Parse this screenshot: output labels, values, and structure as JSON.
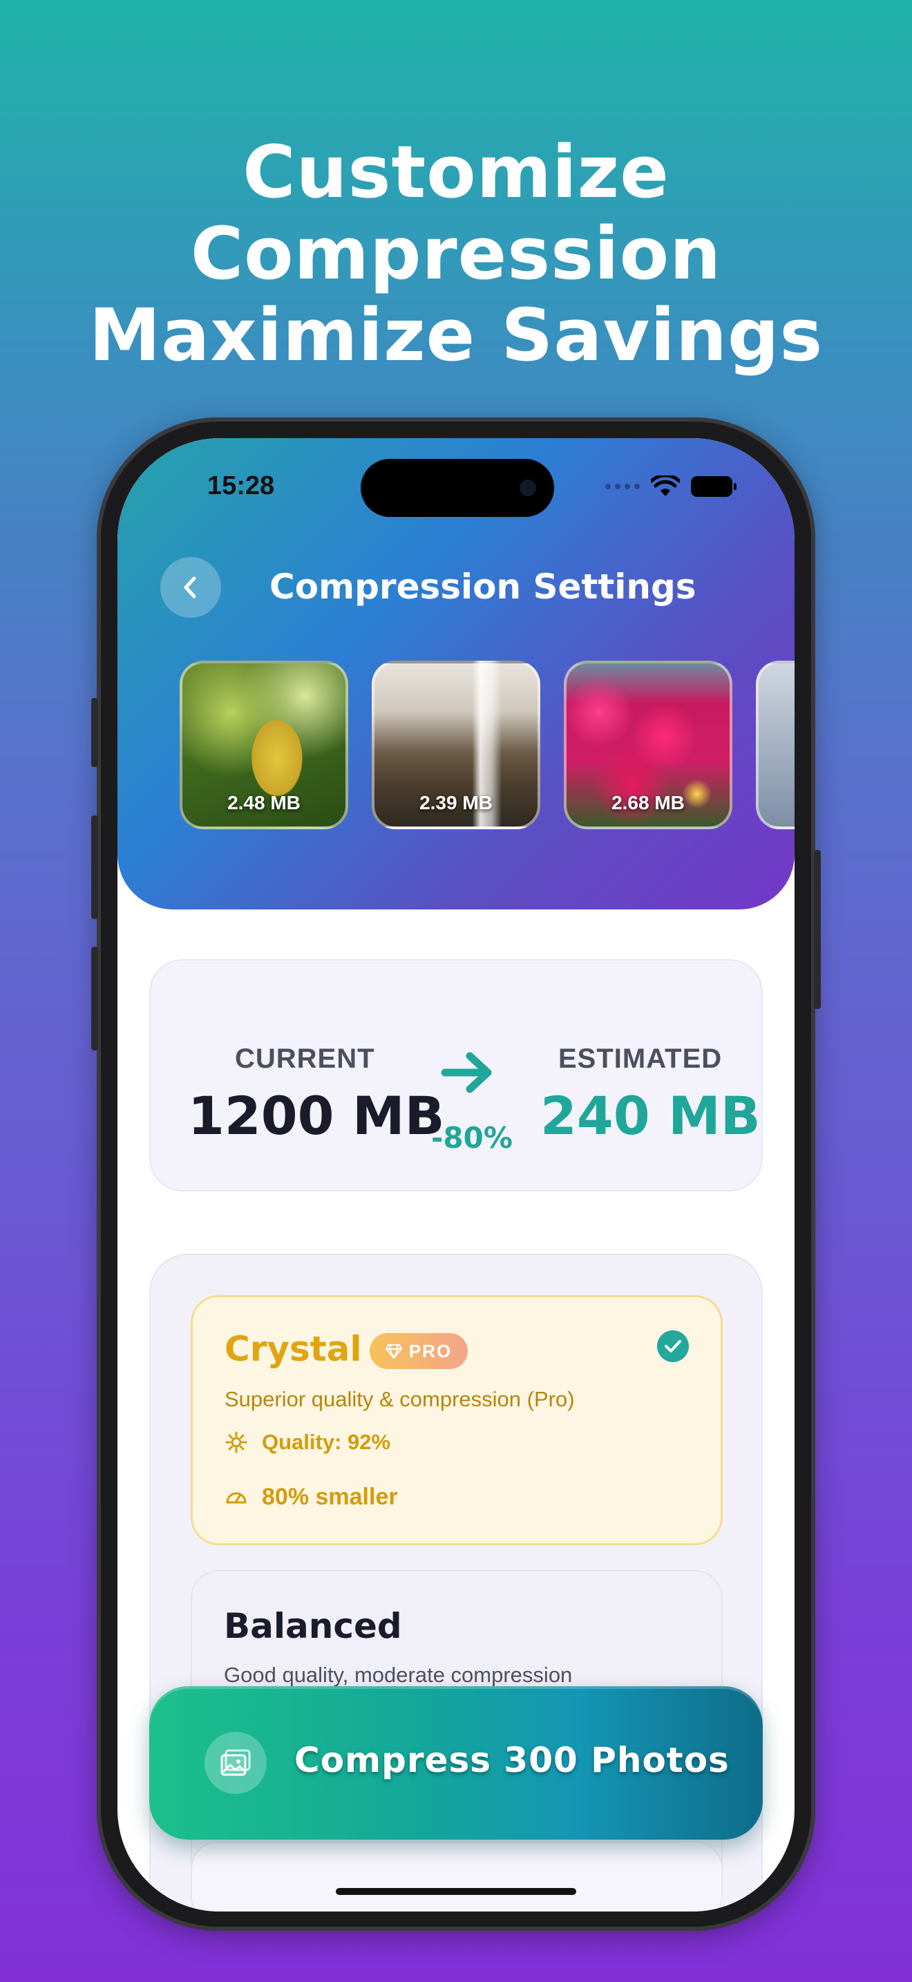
{
  "headline": {
    "line1": "Customize Compression",
    "line2": "Maximize Savings"
  },
  "status_bar": {
    "time": "15:28",
    "icons": [
      "cellular-dots-icon",
      "wifi-icon",
      "battery-icon"
    ]
  },
  "nav": {
    "back_icon": "chevron-left-icon",
    "title": "Compression Settings"
  },
  "photos": [
    {
      "size": "2.48 MB"
    },
    {
      "size": "2.39 MB"
    },
    {
      "size": "2.68 MB"
    }
  ],
  "estimate": {
    "current_label": "CURRENT",
    "current_value": "1200 MB",
    "reduction": "-80%",
    "estimated_label": "ESTIMATED",
    "estimated_value": "240 MB",
    "accent": "#21a69a"
  },
  "options": {
    "crystal": {
      "title": "Crystal",
      "badge": "PRO",
      "description": "Superior quality & compression (Pro)",
      "quality": "Quality: 92%",
      "savings": "80% smaller",
      "selected": true
    },
    "balanced": {
      "title": "Balanced",
      "description": "Good quality, moderate compression"
    }
  },
  "cta": {
    "label": "Compress 300 Photos",
    "icon": "photo-icon"
  }
}
